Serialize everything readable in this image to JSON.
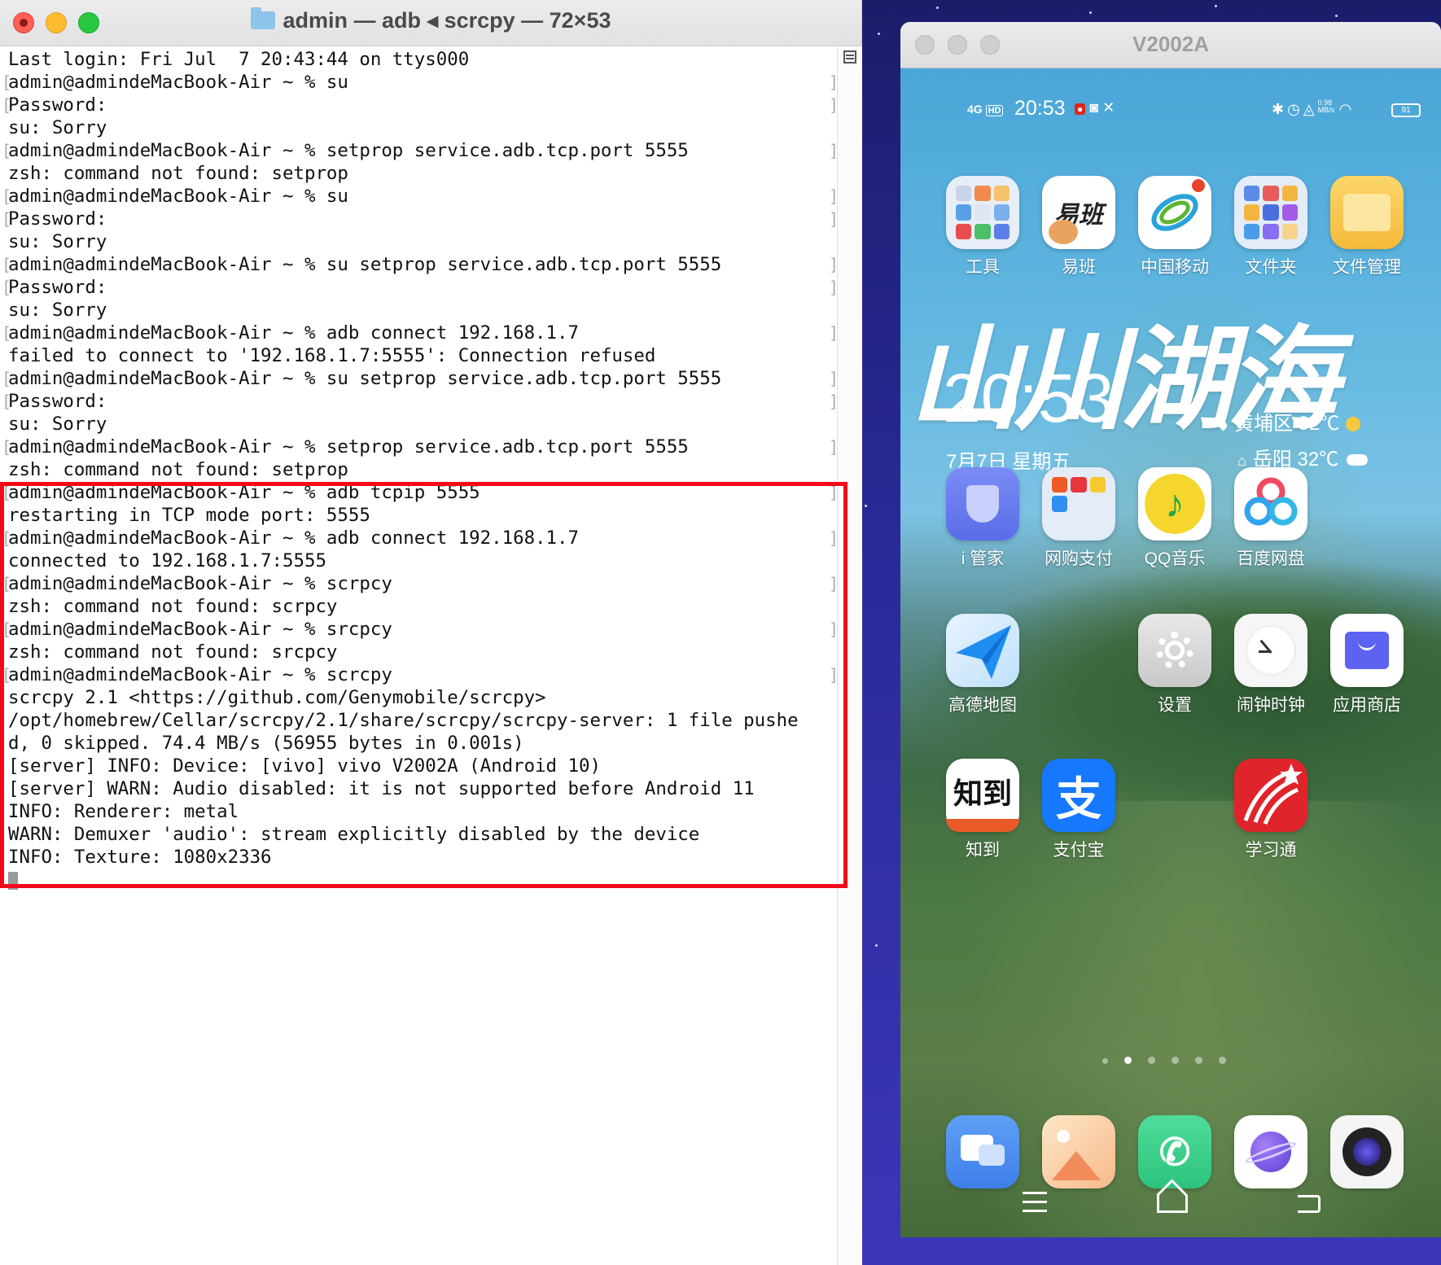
{
  "terminal": {
    "title": "admin — adb ◂ scrcpy — 72×53",
    "lines": [
      {
        "text": "Last login: Fri Jul  7 20:43:44 on ttys000",
        "bracket": false
      },
      {
        "text": "admin@admindeMacBook-Air ~ % su",
        "bracket": true
      },
      {
        "text": "Password:",
        "bracket": true
      },
      {
        "text": "su: Sorry",
        "bracket": false
      },
      {
        "text": "admin@admindeMacBook-Air ~ % setprop service.adb.tcp.port 5555",
        "bracket": true
      },
      {
        "text": "zsh: command not found: setprop",
        "bracket": false
      },
      {
        "text": "admin@admindeMacBook-Air ~ % su",
        "bracket": true
      },
      {
        "text": "Password:",
        "bracket": true
      },
      {
        "text": "su: Sorry",
        "bracket": false
      },
      {
        "text": "admin@admindeMacBook-Air ~ % su setprop service.adb.tcp.port 5555",
        "bracket": true
      },
      {
        "text": "Password:",
        "bracket": true
      },
      {
        "text": "su: Sorry",
        "bracket": false
      },
      {
        "text": "admin@admindeMacBook-Air ~ % adb connect 192.168.1.7",
        "bracket": true
      },
      {
        "text": "failed to connect to '192.168.1.7:5555': Connection refused",
        "bracket": false
      },
      {
        "text": "admin@admindeMacBook-Air ~ % su setprop service.adb.tcp.port 5555",
        "bracket": true
      },
      {
        "text": "Password:",
        "bracket": true
      },
      {
        "text": "su: Sorry",
        "bracket": false
      },
      {
        "text": "admin@admindeMacBook-Air ~ % setprop service.adb.tcp.port 5555",
        "bracket": true
      },
      {
        "text": "zsh: command not found: setprop",
        "bracket": false
      },
      {
        "text": "admin@admindeMacBook-Air ~ % adb tcpip 5555",
        "bracket": true
      },
      {
        "text": "restarting in TCP mode port: 5555",
        "bracket": false
      },
      {
        "text": "admin@admindeMacBook-Air ~ % adb connect 192.168.1.7",
        "bracket": true
      },
      {
        "text": "connected to 192.168.1.7:5555",
        "bracket": false
      },
      {
        "text": "admin@admindeMacBook-Air ~ % scrpcy",
        "bracket": true
      },
      {
        "text": "zsh: command not found: scrpcy",
        "bracket": false
      },
      {
        "text": "admin@admindeMacBook-Air ~ % srcpcy",
        "bracket": true
      },
      {
        "text": "zsh: command not found: srcpcy",
        "bracket": false
      },
      {
        "text": "admin@admindeMacBook-Air ~ % scrcpy",
        "bracket": true
      },
      {
        "text": "scrcpy 2.1 <https://github.com/Genymobile/scrcpy>",
        "bracket": false
      },
      {
        "text": "/opt/homebrew/Cellar/scrcpy/2.1/share/scrcpy/scrcpy-server: 1 file pushe",
        "bracket": false
      },
      {
        "text": "d, 0 skipped. 74.4 MB/s (56955 bytes in 0.001s)",
        "bracket": false
      },
      {
        "text": "[server] INFO: Device: [vivo] vivo V2002A (Android 10)",
        "bracket": false
      },
      {
        "text": "[server] WARN: Audio disabled: it is not supported before Android 11",
        "bracket": false
      },
      {
        "text": "INFO: Renderer: metal",
        "bracket": false
      },
      {
        "text": "WARN: Demuxer 'audio': stream explicitly disabled by the device",
        "bracket": false
      },
      {
        "text": "INFO: Texture: 1080x2336",
        "bracket": false
      }
    ],
    "highlight_color": "#f20a18"
  },
  "phone": {
    "window_title": "V2002A",
    "status": {
      "network": "4G",
      "hd": "HD",
      "time": "20:53",
      "speed": "0.98 MB/s",
      "battery": "91"
    },
    "widget": {
      "big_text": "山川湖海",
      "time": "20:53",
      "date": "7月7日 星期五",
      "weather_current": "黄埔区 32℃",
      "weather_home": "岳阳 32℃"
    },
    "apps": [
      {
        "label": "工具",
        "icon": "folder-tools-icon"
      },
      {
        "label": "易班",
        "icon": "yiban-icon",
        "glyph": "易班"
      },
      {
        "label": "中国移动",
        "icon": "china-mobile-icon"
      },
      {
        "label": "文件夹",
        "icon": "folder-icon"
      },
      {
        "label": "文件管理",
        "icon": "file-manager-icon"
      },
      {
        "label": "i 管家",
        "icon": "shield-icon"
      },
      {
        "label": "网购支付",
        "icon": "shopping-folder-icon"
      },
      {
        "label": "QQ音乐",
        "icon": "qq-music-icon"
      },
      {
        "label": "百度网盘",
        "icon": "baidu-netdisk-icon"
      },
      {
        "label": "高德地图",
        "icon": "amap-icon"
      },
      {
        "label": "设置",
        "icon": "settings-gear-icon"
      },
      {
        "label": "闹钟时钟",
        "icon": "clock-icon"
      },
      {
        "label": "应用商店",
        "icon": "app-store-icon"
      },
      {
        "label": "知到",
        "icon": "zhidao-icon",
        "glyph": "知到"
      },
      {
        "label": "支付宝",
        "icon": "alipay-icon",
        "glyph": "支"
      },
      {
        "label": "学习通",
        "icon": "xuexitong-icon"
      }
    ],
    "dock": [
      {
        "icon": "messages-icon"
      },
      {
        "icon": "gallery-icon"
      },
      {
        "icon": "phone-icon"
      },
      {
        "icon": "browser-icon"
      },
      {
        "icon": "camera-icon"
      }
    ],
    "page_dots": {
      "count": 6,
      "active": 1
    }
  }
}
